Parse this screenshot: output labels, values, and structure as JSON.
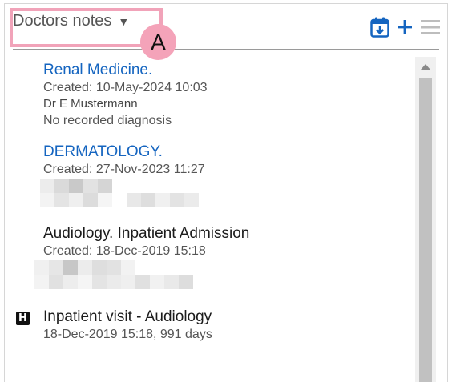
{
  "header": {
    "title": "Doctors notes",
    "caret": "▼",
    "annotation_label": "A"
  },
  "colors": {
    "accent": "#1565c0",
    "highlight": "#f1a3b9",
    "badge": "#f4a3b9",
    "muted": "#555555"
  },
  "icons": {
    "calendar": "calendar-download-icon",
    "add": "plus-icon",
    "menu": "hamburger-menu-icon",
    "hospital": "hospital-h-icon"
  },
  "notes": [
    {
      "title": "Renal Medicine.",
      "created": "Created: 10-May-2024 10:03",
      "author": "Dr E Mustermann",
      "diagnosis": "No recorded diagnosis"
    },
    {
      "title": "DERMATOLOGY.",
      "created": "Created: 27-Nov-2023 11:27"
    },
    {
      "title": "Audiology. Inpatient Admission",
      "created": "Created: 18-Dec-2019 15:18"
    }
  ],
  "visit": {
    "title": "Inpatient visit - Audiology",
    "details": "18-Dec-2019 15:18, 991 days"
  }
}
